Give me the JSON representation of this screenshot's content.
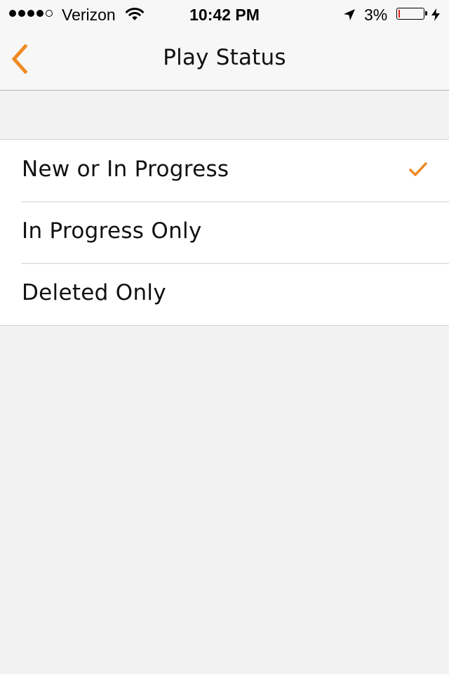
{
  "status_bar": {
    "carrier": "Verizon",
    "signal_bars_filled": 4,
    "signal_bars_total": 5,
    "time": "10:42 PM",
    "battery_percent": "3%",
    "icons": [
      "signal-dots-icon",
      "wifi-icon",
      "location-arrow-icon",
      "battery-icon",
      "charging-bolt-icon"
    ]
  },
  "nav": {
    "title": "Play Status",
    "back_icon": "chevron-left-icon"
  },
  "options": [
    {
      "label": "New or In Progress",
      "selected": true
    },
    {
      "label": "In Progress Only",
      "selected": false
    },
    {
      "label": "Deleted Only",
      "selected": false
    }
  ],
  "colors": {
    "accent": "#f08a24",
    "background": "#f2f2f2",
    "list_background": "#ffffff",
    "battery_low": "#e01e1e"
  }
}
